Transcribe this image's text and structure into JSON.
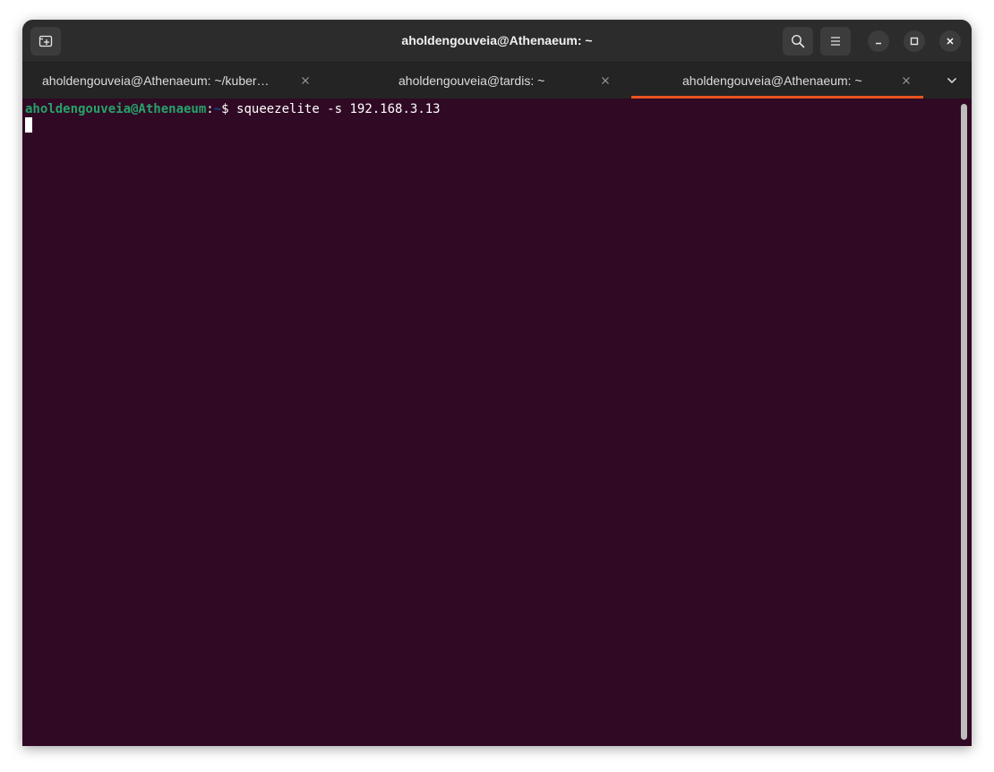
{
  "window": {
    "title": "aholdengouveia@Athenaeum: ~"
  },
  "header": {
    "new_tab_icon": "new-tab-icon",
    "search_icon": "search-icon",
    "menu_icon": "hamburger-menu-icon",
    "minimize_icon": "minimize-icon",
    "maximize_icon": "maximize-icon",
    "close_icon": "close-icon"
  },
  "tabs": [
    {
      "label": "aholdengouveia@Athenaeum: ~/kuber…",
      "active": false
    },
    {
      "label": "aholdengouveia@tardis: ~",
      "active": false
    },
    {
      "label": "aholdengouveia@Athenaeum: ~",
      "active": true
    }
  ],
  "terminal": {
    "prompt_user": "aholdengouveia@Athenaeum",
    "prompt_colon": ":",
    "prompt_path": "~",
    "prompt_dollar": "$",
    "command": " squeezelite -s 192.168.3.13"
  },
  "colors": {
    "terminal_bg": "#300a24",
    "prompt_user": "#26a269",
    "prompt_path": "#12488b",
    "active_tab_accent": "#e95420",
    "titlebar_bg": "#2c2c2c",
    "tabbar_bg": "#242424"
  }
}
